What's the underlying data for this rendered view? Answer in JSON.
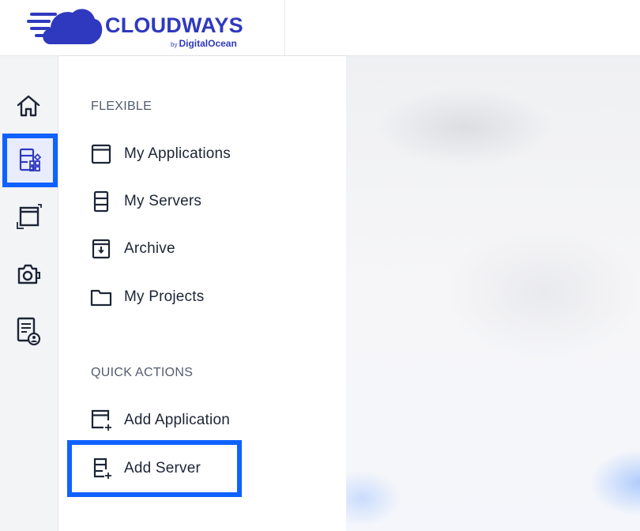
{
  "brand": {
    "name": "CLOUDWAYS",
    "sub_prefix": "by",
    "sub_name": "DigitalOcean",
    "color": "#2f39bf"
  },
  "rail": {
    "items": [
      {
        "icon": "home-icon"
      },
      {
        "icon": "applications-servers-icon",
        "active": true
      },
      {
        "icon": "window-icon"
      },
      {
        "icon": "camera-addon-icon"
      },
      {
        "icon": "account-document-icon"
      }
    ],
    "active_color": "#0f62fe"
  },
  "menu": {
    "flexible_label": "FLEXIBLE",
    "flexible_items": [
      {
        "label": "My Applications",
        "icon": "application-window-icon"
      },
      {
        "label": "My Servers",
        "icon": "server-icon"
      },
      {
        "label": "Archive",
        "icon": "archive-box-icon"
      },
      {
        "label": "My Projects",
        "icon": "folder-icon"
      }
    ],
    "quick_label": "QUICK ACTIONS",
    "quick_items": [
      {
        "label": "Add Application",
        "icon": "add-application-icon"
      },
      {
        "label": "Add Server",
        "icon": "add-server-icon"
      }
    ]
  }
}
